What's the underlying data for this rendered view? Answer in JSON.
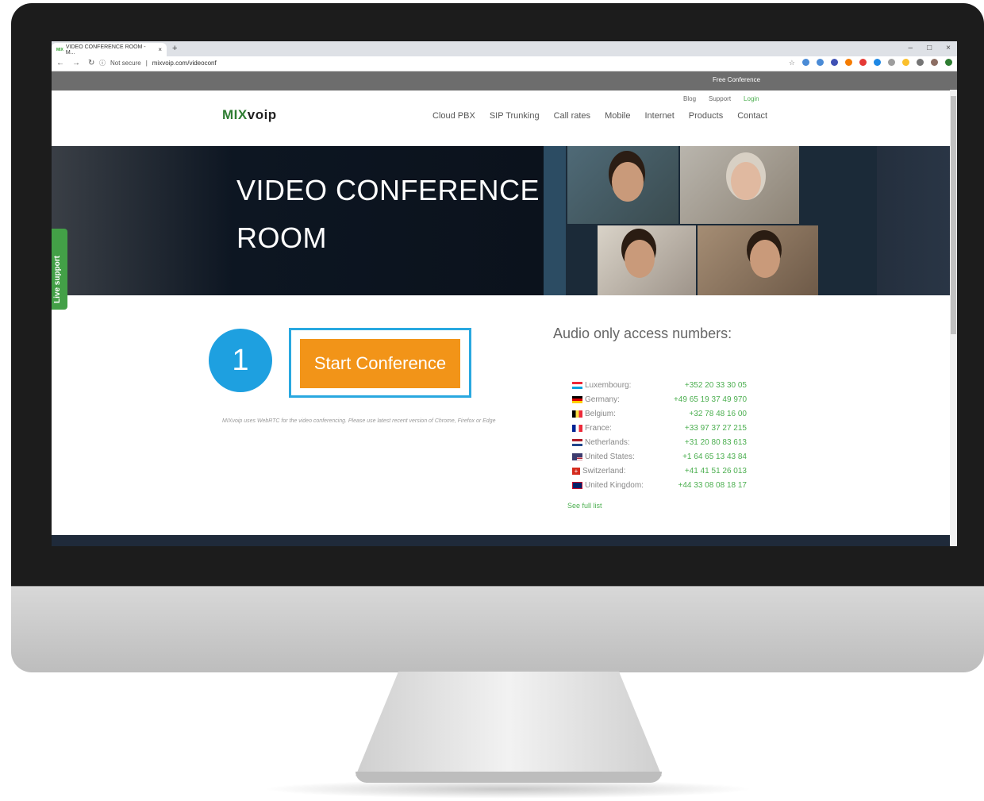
{
  "browser": {
    "tab_title": "VIDEO CONFERENCE ROOM - M...",
    "tab_favicon": "MIX",
    "new_tab": "+",
    "security": "Not secure",
    "url": "mixvoip.com/videoconf",
    "window_controls": [
      "–",
      "□",
      "×"
    ]
  },
  "site": {
    "top_strip": "Free Conference",
    "sublinks": {
      "blog": "Blog",
      "support": "Support",
      "login": "Login"
    },
    "logo_mix": "MIX",
    "logo_voip": "voip",
    "nav": [
      "Cloud PBX",
      "SIP Trunking",
      "Call rates",
      "Mobile",
      "Internet",
      "Products",
      "Contact"
    ],
    "hero_title_line1": "VIDEO CONFERENCE",
    "hero_title_line2": "ROOM",
    "live_support": "Live support",
    "start_button": "Start Conference",
    "step_number": "1",
    "note": "MIXvoip uses WebRTC for the video conferencing. Please use latest recent version of Chrome, Firefox or Edge",
    "audio_heading": "Audio only access numbers:",
    "numbers": [
      {
        "country": "Luxembourg:",
        "number": "+352 20 33 30 05",
        "flag": "luxembourg-flag-icon"
      },
      {
        "country": "Germany:",
        "number": "+49 65 19 37 49 970",
        "flag": "germany-flag-icon"
      },
      {
        "country": "Belgium:",
        "number": "+32 78 48 16 00",
        "flag": "belgium-flag-icon"
      },
      {
        "country": "France:",
        "number": "+33 97 37 27 215",
        "flag": "france-flag-icon"
      },
      {
        "country": "Netherlands:",
        "number": "+31 20 80 83 613",
        "flag": "netherlands-flag-icon"
      },
      {
        "country": "United States:",
        "number": "+1 64 65 13 43 84",
        "flag": "usa-flag-icon"
      },
      {
        "country": "Switzerland:",
        "number": "+41 41 51 26 013",
        "flag": "switzerland-flag-icon"
      },
      {
        "country": "United Kingdom:",
        "number": "+44 33 08 08 18 17",
        "flag": "uk-flag-icon"
      }
    ],
    "see_full_list": "See full list"
  },
  "colors": {
    "accent_orange": "#f29418",
    "callout_blue": "#29a8e0",
    "brand_green": "#2e7d32",
    "link_green": "#4caf50"
  }
}
